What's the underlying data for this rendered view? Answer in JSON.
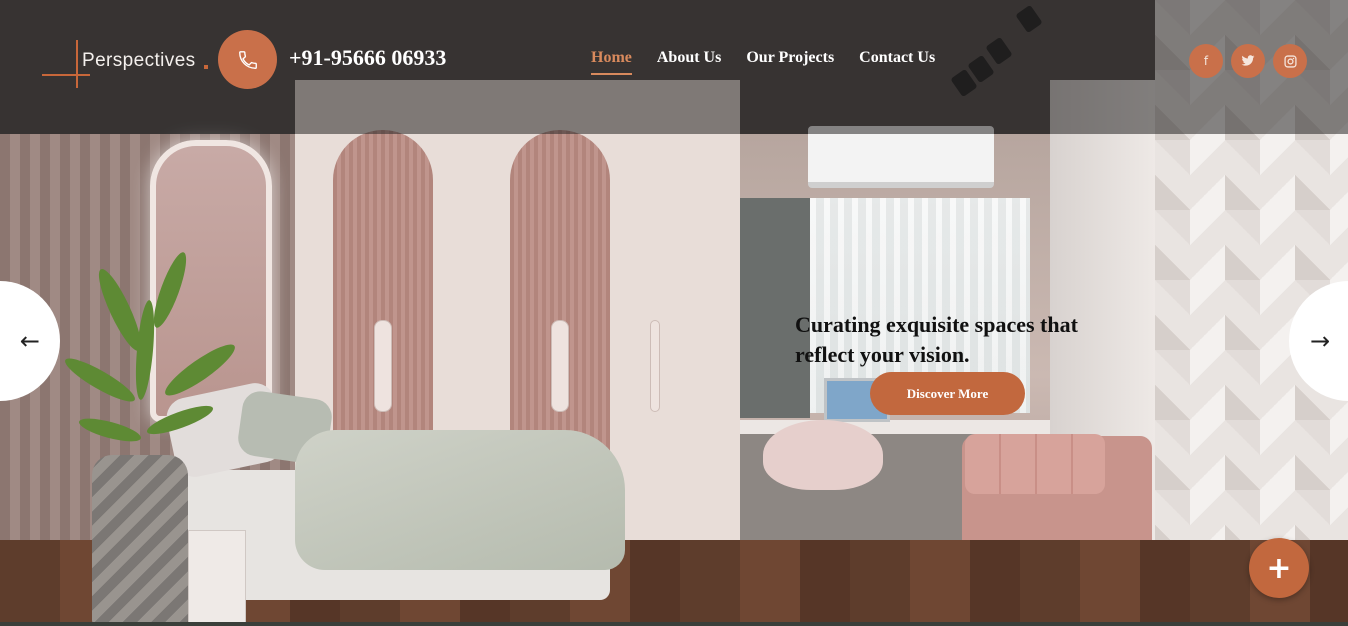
{
  "brand": {
    "name": "Perspectives",
    "accent_color": "#c2683e"
  },
  "header": {
    "phone_icon": "phone-icon",
    "phone_number": "+91-95666 06933",
    "nav": [
      {
        "label": "Home",
        "active": true
      },
      {
        "label": "About Us",
        "active": false
      },
      {
        "label": "Our Projects",
        "active": false
      },
      {
        "label": "Contact Us",
        "active": false
      }
    ],
    "social": [
      {
        "icon": "facebook-icon",
        "glyph": "f"
      },
      {
        "icon": "twitter-icon",
        "glyph": "t"
      },
      {
        "icon": "instagram-icon",
        "glyph": "◎"
      }
    ]
  },
  "hero": {
    "headline": "Curating exquisite spaces that reflect your vision.",
    "cta_label": "Discover More",
    "prev_glyph": "←",
    "next_glyph": "→"
  },
  "fab": {
    "glyph": "+"
  }
}
